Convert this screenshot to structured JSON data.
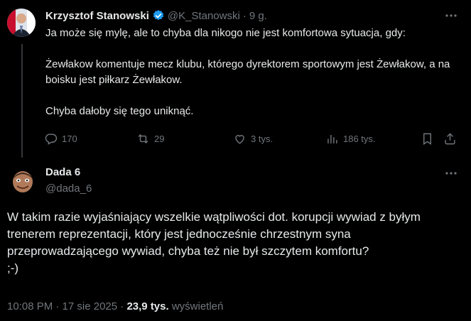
{
  "parent_tweet": {
    "author_name": "Krzysztof Stanowski",
    "handle": "@K_Stanowski",
    "separator": "·",
    "time": "9 g.",
    "text": "Ja może się mylę, ale to chyba dla nikogo nie jest komfortowa sytuacja, gdy:\n\nŻewłakow komentuje mecz klubu, którego dyrektorem sportowym jest Żewłakow, a na boisku jest piłkarz Żewłakow.\n\nChyba dałoby się tego uniknąć.",
    "actions": {
      "replies": "170",
      "reposts": "29",
      "likes": "3 tys.",
      "views": "186 tys."
    }
  },
  "reply_tweet": {
    "author_name": "Dada 6",
    "handle": "@dada_6",
    "text": "W takim razie wyjaśniający wszelkie wątpliwości dot. korupcji wywiad z byłym trenerem reprezentacji, który jest jednocześnie chrzestnym syna przeprowadzającego wywiad, chyba też nie był szczytem komfortu?\n;-)",
    "timestamp": "10:08 PM · 17 sie 2025",
    "separator": "·",
    "views_count": "23,9 tys.",
    "views_label": "wyświetleń"
  },
  "icons": {
    "verified": "verified-badge-icon",
    "more": "more-icon",
    "reply": "reply-icon",
    "repost": "repost-icon",
    "like": "like-icon",
    "views": "views-icon",
    "bookmark": "bookmark-icon",
    "share": "share-icon"
  },
  "colors": {
    "background": "#000000",
    "text": "#e7e9ea",
    "muted": "#71767b",
    "verified": "#1d9bf0",
    "thread_line": "#333639"
  }
}
